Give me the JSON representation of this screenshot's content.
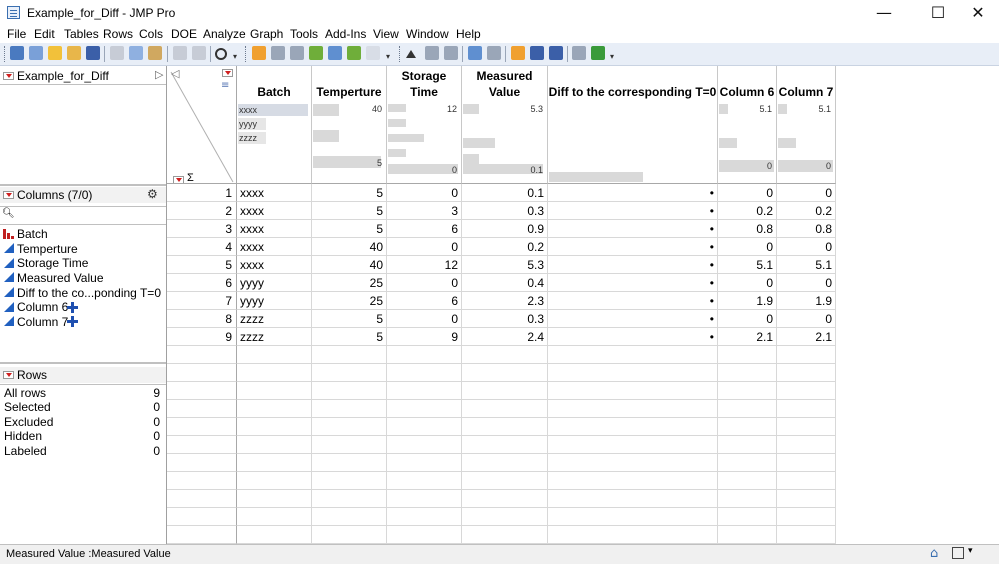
{
  "window": {
    "title": "Example_for_Diff - JMP Pro",
    "minimize": "—",
    "maximize": "☐",
    "close": "✕"
  },
  "menu": [
    "File",
    "Edit",
    "Tables",
    "Rows",
    "Cols",
    "DOE",
    "Analyze",
    "Graph",
    "Tools",
    "Add-Ins",
    "View",
    "Window",
    "Help"
  ],
  "table_panel": {
    "name": "Example_for_Diff"
  },
  "columns_panel": {
    "header": "Columns (7/0)",
    "search_placeholder": "",
    "items": [
      {
        "name": "Batch",
        "type": "nominal"
      },
      {
        "name": "Temperture",
        "type": "continuous"
      },
      {
        "name": "Storage Time",
        "type": "continuous"
      },
      {
        "name": "Measured Value",
        "type": "continuous"
      },
      {
        "name": "Diff to the co...ponding T=0",
        "type": "continuous"
      },
      {
        "name": "Column 6",
        "type": "continuous",
        "formula": true
      },
      {
        "name": "Column 7",
        "type": "continuous",
        "formula": true
      }
    ]
  },
  "rows_panel": {
    "header": "Rows",
    "items": [
      {
        "label": "All rows",
        "value": "9"
      },
      {
        "label": "Selected",
        "value": "0"
      },
      {
        "label": "Excluded",
        "value": "0"
      },
      {
        "label": "Hidden",
        "value": "0"
      },
      {
        "label": "Labeled",
        "value": "0"
      }
    ]
  },
  "grid": {
    "sigma": "Σ",
    "headers": [
      "Batch",
      "Temperture",
      "Storage\nTime",
      "Measured\nValue",
      "Diff to the corresponding T=0",
      "Column 6",
      "Column 7"
    ],
    "summary": {
      "batch_levels": [
        "xxxx",
        "yyyy",
        "zzzz"
      ],
      "temperture": {
        "max": "40",
        "min": "5"
      },
      "storage_time": {
        "max": "12",
        "min": "0"
      },
      "measured_value": {
        "max": "5.3",
        "min": "0.1"
      },
      "column6": {
        "max": "5.1",
        "min": "0"
      },
      "column7": {
        "max": "5.1",
        "min": "0"
      }
    },
    "rows": [
      [
        "1",
        "xxxx",
        "5",
        "0",
        "0.1",
        "•",
        "0",
        "0"
      ],
      [
        "2",
        "xxxx",
        "5",
        "3",
        "0.3",
        "•",
        "0.2",
        "0.2"
      ],
      [
        "3",
        "xxxx",
        "5",
        "6",
        "0.9",
        "•",
        "0.8",
        "0.8"
      ],
      [
        "4",
        "xxxx",
        "40",
        "0",
        "0.2",
        "•",
        "0",
        "0"
      ],
      [
        "5",
        "xxxx",
        "40",
        "12",
        "5.3",
        "•",
        "5.1",
        "5.1"
      ],
      [
        "6",
        "yyyy",
        "25",
        "0",
        "0.4",
        "•",
        "0",
        "0"
      ],
      [
        "7",
        "yyyy",
        "25",
        "6",
        "2.3",
        "•",
        "1.9",
        "1.9"
      ],
      [
        "8",
        "zzzz",
        "5",
        "0",
        "0.3",
        "•",
        "0",
        "0"
      ],
      [
        "9",
        "zzzz",
        "5",
        "9",
        "2.4",
        "•",
        "2.1",
        "2.1"
      ]
    ]
  },
  "status": {
    "text": "Measured Value :Measured Value"
  }
}
